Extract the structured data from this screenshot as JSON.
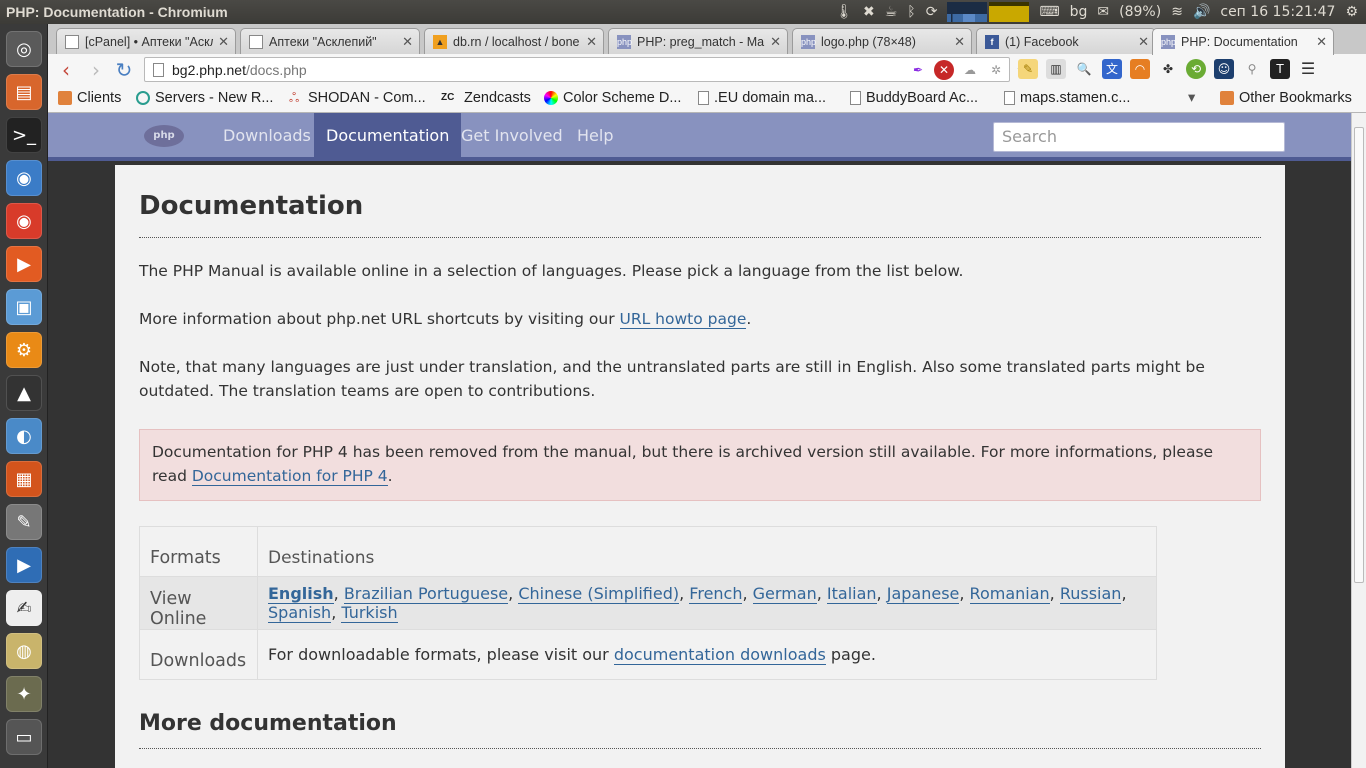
{
  "system": {
    "window_title": "PHP: Documentation - Chromium",
    "keyboard_layout": "bg",
    "battery": "(89%)",
    "clock": "сеп 16  15:21:47"
  },
  "tabs": [
    {
      "label": "[cPanel] • Аптеки \"Аскл",
      "icon": "page-icon"
    },
    {
      "label": "Аптеки \"Асклепий\"",
      "icon": "page-icon"
    },
    {
      "label": "db.rn / localhost / bone",
      "icon": "phpmyadmin-icon"
    },
    {
      "label": "PHP: preg_match - Man",
      "icon": "php-icon"
    },
    {
      "label": "logo.php (78×48)",
      "icon": "php-icon"
    },
    {
      "label": "(1) Facebook",
      "icon": "facebook-icon"
    },
    {
      "label": "PHP: Documentation",
      "icon": "php-icon",
      "active": true
    }
  ],
  "omnibox": {
    "host": "bg2.php.net",
    "path": "/docs.php"
  },
  "bookmarks": [
    {
      "label": "Clients",
      "icon": "folder-icon"
    },
    {
      "label": "Servers - New R...",
      "icon": "globe-icon"
    },
    {
      "label": "SHODAN - Com...",
      "icon": "shodan-icon"
    },
    {
      "label": "Zendcasts",
      "icon": "zc-icon"
    },
    {
      "label": "Color Scheme D...",
      "icon": "color-wheel-icon"
    },
    {
      "label": ".EU domain ma...",
      "icon": "page-icon"
    },
    {
      "label": "BuddyBoard Ac...",
      "icon": "page-icon"
    },
    {
      "label": "maps.stamen.c...",
      "icon": "page-icon"
    },
    {
      "label": "Other Bookmarks",
      "icon": "folder-icon"
    }
  ],
  "phpnav": {
    "logo": "php",
    "items": [
      "Downloads",
      "Documentation",
      "Get Involved",
      "Help"
    ],
    "active": "Documentation",
    "search_placeholder": "Search"
  },
  "content": {
    "title": "Documentation",
    "p1": "The PHP Manual is available online in a selection of languages. Please pick a language from the list below.",
    "p2_before": "More information about php.net URL shortcuts by visiting our ",
    "p2_link": "URL howto page",
    "p2_after": ".",
    "p3": "Note, that many languages are just under translation, and the untranslated parts are still in English. Also some translated parts might be outdated. The translation teams are open to contributions.",
    "warning_text": "Documentation for PHP 4 has been removed from the manual, but there is archived version still available. For more informations, please read ",
    "warning_link": "Documentation for PHP 4",
    "warning_after": ".",
    "table": {
      "header_formats": "Formats",
      "header_destinations": "Destinations",
      "row1_label": "View Online",
      "languages": [
        "English",
        "Brazilian Portuguese",
        "Chinese (Simplified)",
        "French",
        "German",
        "Italian",
        "Japanese",
        "Romanian",
        "Russian",
        "Spanish",
        "Turkish"
      ],
      "row2_label": "Downloads",
      "row2_before": "For downloadable formats, please visit our ",
      "row2_link": "documentation downloads",
      "row2_after": " page."
    },
    "more_title": "More documentation"
  },
  "colors": {
    "php_nav": "#8892bf",
    "php_nav_active": "#4f5b93",
    "link": "#336699",
    "warning_bg": "#f2dede"
  }
}
